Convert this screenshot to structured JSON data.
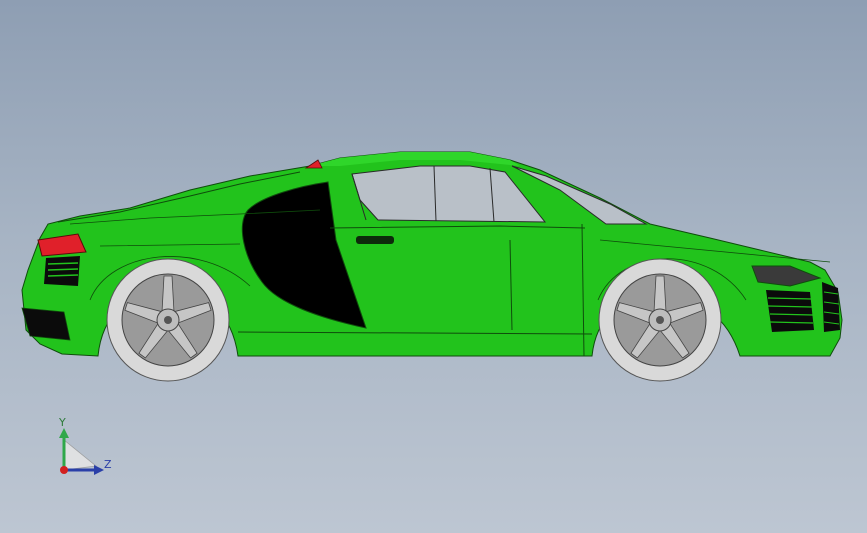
{
  "viewport": {
    "background_top": "#8e9eb3",
    "background_bottom": "#bdc6d2"
  },
  "model": {
    "body_color": "#22c31c",
    "body_shade": "#1a9d16",
    "glass_color": "#b9c0c8",
    "tire_color": "#d9d9d9",
    "rim_color": "#8c8c8c",
    "taillight_color": "#e0202a"
  },
  "triad": {
    "y_label": "Y",
    "z_label": "Z",
    "y_color": "#2fa84a",
    "z_color": "#2a3fa8",
    "x_color": "#d22020"
  }
}
